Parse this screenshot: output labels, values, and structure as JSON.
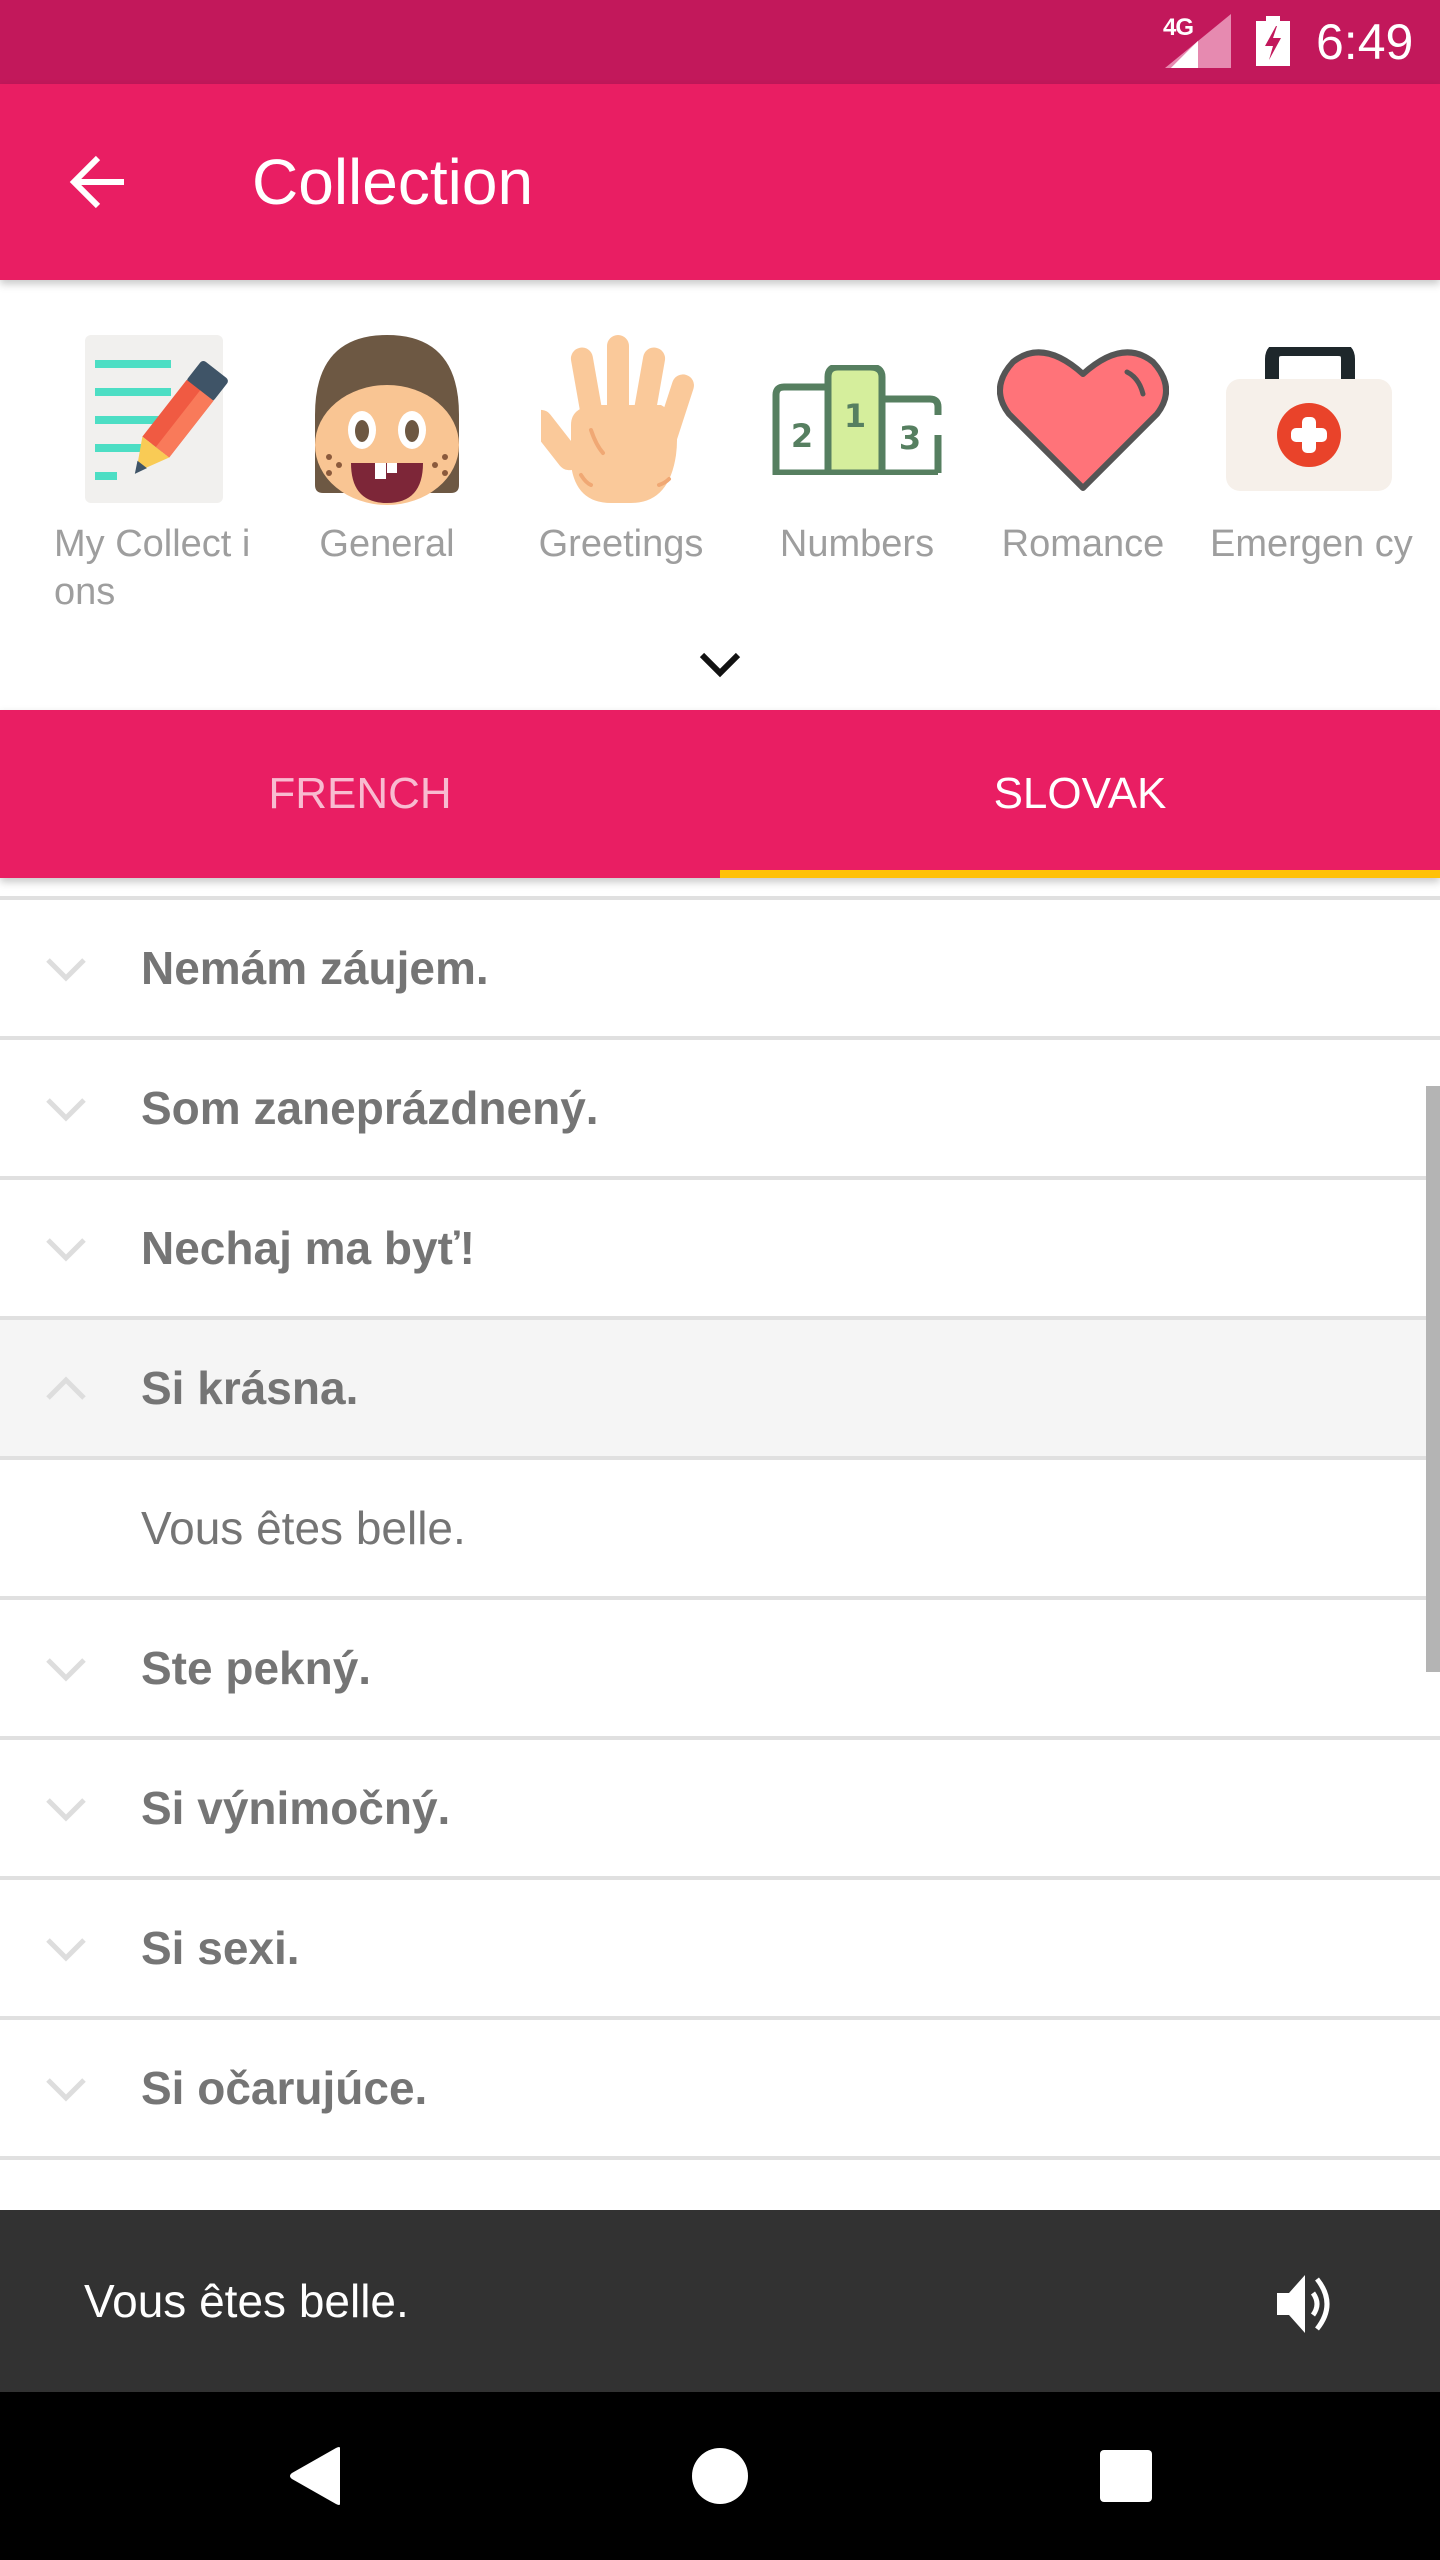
{
  "status_bar": {
    "network": "4G",
    "time": "6:49",
    "signal_icon": "signal-icon",
    "battery_icon": "battery-charging-icon"
  },
  "app_bar": {
    "title": "Collection",
    "back_icon": "arrow-back-icon"
  },
  "categories": [
    {
      "label": "My Collect ions",
      "icon": "notepad-pencil-icon"
    },
    {
      "label": "General",
      "icon": "face-icon"
    },
    {
      "label": "Greetings",
      "icon": "waving-hand-icon"
    },
    {
      "label": "Numbers",
      "icon": "podium-icon"
    },
    {
      "label": "Romance",
      "icon": "heart-icon"
    },
    {
      "label": "Emergen cy",
      "icon": "first-aid-kit-icon"
    }
  ],
  "expand_icon": "chevron-down-icon",
  "tabs": [
    {
      "label": "FRENCH",
      "selected": false
    },
    {
      "label": "SLOVAK",
      "selected": true
    }
  ],
  "colors": {
    "status_bar": "#C2185B",
    "primary": "#E91E63",
    "tab_indicator": "#FFC107",
    "snackbar": "#323232",
    "list_text": "#757575",
    "divider": "#E0E0E0"
  },
  "phrases": [
    {
      "text": "Nemám záujem.",
      "expanded": false
    },
    {
      "text": "Som zaneprázdnený.",
      "expanded": false
    },
    {
      "text": "Nechaj ma byť!",
      "expanded": false
    },
    {
      "text": "Si krásna.",
      "expanded": true,
      "translation": "Vous êtes belle."
    },
    {
      "text": "Ste pekný.",
      "expanded": false
    },
    {
      "text": "Si výnimočný.",
      "expanded": false
    },
    {
      "text": "Si sexi.",
      "expanded": false
    },
    {
      "text": "Si očarujúce.",
      "expanded": false
    }
  ],
  "snackbar": {
    "message": "Vous êtes belle.",
    "action_icon": "speaker-icon"
  },
  "nav_bar": {
    "back": "nav-back-icon",
    "home": "nav-home-icon",
    "recents": "nav-recents-icon"
  }
}
